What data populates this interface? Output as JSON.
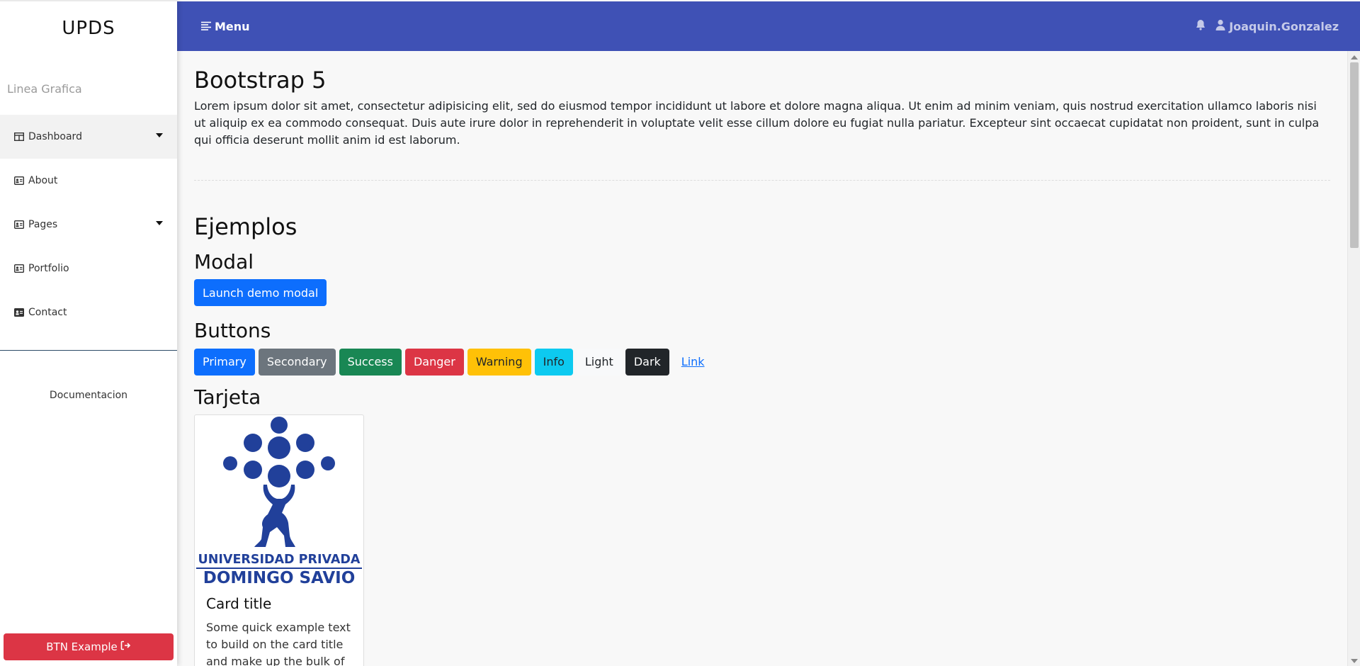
{
  "sidebar": {
    "brand": "UPDS",
    "subtitle": "Linea Grafica",
    "items": [
      {
        "label": "Dashboard",
        "icon": "table-icon",
        "dropdown": true
      },
      {
        "label": "About",
        "icon": "id-card-icon",
        "dropdown": false
      },
      {
        "label": "Pages",
        "icon": "id-card-icon",
        "dropdown": true
      },
      {
        "label": "Portfolio",
        "icon": "id-card-icon",
        "dropdown": false
      },
      {
        "label": "Contact",
        "icon": "address-card-icon",
        "dropdown": false
      }
    ],
    "doc_link": "Documentacion",
    "bottom_button": "BTN Example"
  },
  "header": {
    "menu_label": "Menu",
    "user_name": "Joaquin.Gonzalez"
  },
  "main": {
    "title": "Bootstrap 5",
    "lorem": "Lorem ipsum dolor sit amet, consectetur adipisicing elit, sed do eiusmod tempor incididunt ut labore et dolore magna aliqua. Ut enim ad minim veniam, quis nostrud exercitation ullamco laboris nisi ut aliquip ex ea commodo consequat. Duis aute irure dolor in reprehenderit in voluptate velit esse cillum dolore eu fugiat nulla pariatur. Excepteur sint occaecat cupidatat non proident, sunt in culpa qui officia deserunt mollit anim id est laborum.",
    "examples_title": "Ejemplos",
    "modal_title": "Modal",
    "modal_button": "Launch demo modal",
    "buttons_title": "Buttons",
    "buttons": [
      "Primary",
      "Secondary",
      "Success",
      "Danger",
      "Warning",
      "Info",
      "Light",
      "Dark",
      "Link"
    ],
    "card_section_title": "Tarjeta",
    "card": {
      "logo_line1": "UNIVERSIDAD PRIVADA",
      "logo_line2": "DOMINGO SAVIO",
      "title": "Card title",
      "text": "Some quick example text to build on the card title and make up the bulk of the card's content."
    }
  },
  "colors": {
    "header_bg": "#3f51b5",
    "primary": "#0d6efd",
    "danger": "#dc3545",
    "logo_blue": "#21409a"
  }
}
